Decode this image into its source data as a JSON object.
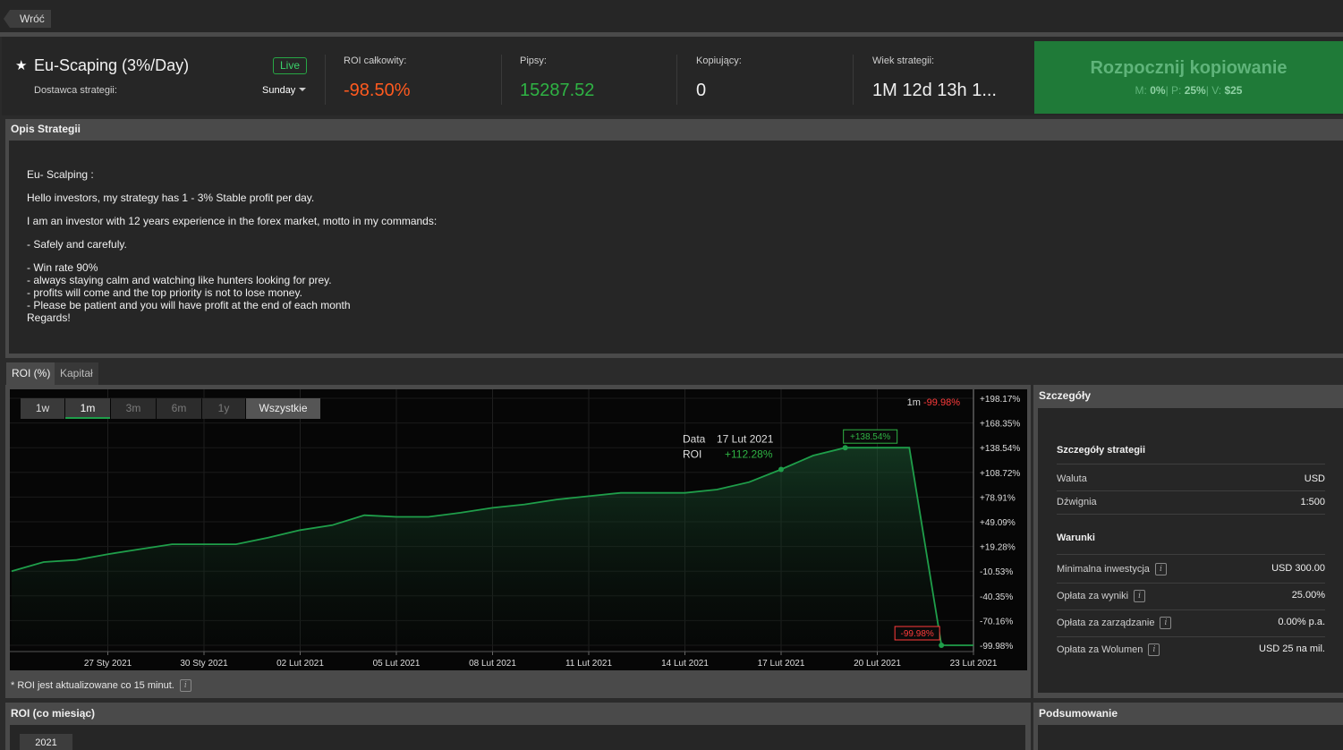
{
  "nav": {
    "back_label": "Wróć"
  },
  "header": {
    "title": "Eu-Scaping (3%/Day)",
    "status_badge": "Live",
    "provider_label": "Dostawca strategii:",
    "provider_name": "Sunday",
    "stats": [
      {
        "label": "ROI całkowity:",
        "value": "-98.50%",
        "color": "#ff5a1f"
      },
      {
        "label": "Pipsy:",
        "value": "15287.52",
        "color": "#2fb344"
      },
      {
        "label": "Kopiujący:",
        "value": "0",
        "color": "#f0f0f0"
      },
      {
        "label": "Wiek strategii:",
        "value": "1M 12d 13h 1...",
        "color": "#f0f0f0"
      }
    ],
    "copy_button": {
      "label": "Rozpocznij kopiowanie",
      "m_label": "M:",
      "m_value": "0%",
      "p_label": "P:",
      "p_value": "25%",
      "v_label": "V:",
      "v_value": "$25"
    }
  },
  "description": {
    "heading": "Opis Strategii",
    "paragraphs": [
      [
        "Eu- Scalping :"
      ],
      [
        "Hello investors, my strategy has 1 - 3% Stable profit per day."
      ],
      [
        "I am an investor with 12 years experience in the forex market, motto in my commands:"
      ],
      [
        "- Safely and carefuly."
      ],
      [
        "- Win rate 90%",
        "- always staying calm and watching like hunters looking for prey.",
        "- profits will come and the top priority is not to lose money.",
        "- Please be patient and you will have profit at the end of each month",
        "Regards!"
      ]
    ]
  },
  "chart_tabs": [
    "ROI (%)",
    "Kapitał"
  ],
  "range_buttons": [
    "1w",
    "1m",
    "3m",
    "6m",
    "1y",
    "Wszystkie"
  ],
  "chart_footnote": "* ROI jest aktualizowane co 15 minut.",
  "chart_data": {
    "type": "area",
    "series": [
      {
        "name": "ROI",
        "x": [
          "24 Sty 2021",
          "25 Sty 2021",
          "26 Sty 2021",
          "27 Sty 2021",
          "28 Sty 2021",
          "29 Sty 2021",
          "30 Sty 2021",
          "31 Sty 2021",
          "01 Lut 2021",
          "02 Lut 2021",
          "03 Lut 2021",
          "04 Lut 2021",
          "05 Lut 2021",
          "06 Lut 2021",
          "07 Lut 2021",
          "08 Lut 2021",
          "09 Lut 2021",
          "10 Lut 2021",
          "11 Lut 2021",
          "12 Lut 2021",
          "13 Lut 2021",
          "14 Lut 2021",
          "15 Lut 2021",
          "16 Lut 2021",
          "17 Lut 2021",
          "18 Lut 2021",
          "19 Lut 2021",
          "20 Lut 2021",
          "21 Lut 2021",
          "22 Lut 2021",
          "23 Lut 2021"
        ],
        "values": [
          -10.5,
          0.5,
          3.0,
          10.0,
          16.0,
          22.0,
          22.0,
          22.0,
          30.0,
          39.0,
          45.0,
          57.0,
          55.0,
          55.0,
          60.0,
          66.0,
          70.0,
          76.0,
          80.0,
          84.0,
          84.0,
          84.0,
          88.0,
          97.0,
          112.28,
          129.0,
          138.54,
          138.54,
          138.54,
          -99.98,
          -99.98
        ]
      }
    ],
    "x_ticks": [
      "27 Sty 2021",
      "30 Sty 2021",
      "02 Lut 2021",
      "05 Lut 2021",
      "08 Lut 2021",
      "11 Lut 2021",
      "14 Lut 2021",
      "17 Lut 2021",
      "20 Lut 2021",
      "23 Lut 2021"
    ],
    "y_ticks": [
      "+198.17%",
      "+168.35%",
      "+138.54%",
      "+108.72%",
      "+78.91%",
      "+49.09%",
      "+19.28%",
      "-10.53%",
      "-40.35%",
      "-70.16%",
      "-99.98%"
    ],
    "ylim": [
      -99.98,
      198.17
    ],
    "legend_text": "1m",
    "legend_value": "-99.98%",
    "tooltip": {
      "date_label": "Data",
      "date_value": "17 Lut 2021",
      "roi_label": "ROI",
      "roi_value": "+112.28%"
    },
    "max_label": "+138.54%",
    "min_label": "-99.98%",
    "grid": true,
    "colors": {
      "line": "#1f9e4a",
      "positive": "#2fb344",
      "negative": "#ff3b3b"
    }
  },
  "details": {
    "heading": "Szczegóły",
    "section1_title": "Szczegóły strategii",
    "rows1": [
      {
        "label": "Waluta",
        "value": "USD"
      },
      {
        "label": "Dźwignia",
        "value": "1:500"
      }
    ],
    "section2_title": "Warunki",
    "rows2": [
      {
        "label": "Minimalna inwestycja",
        "value": "USD 300.00"
      },
      {
        "label": "Opłata za wyniki",
        "value": "25.00%"
      },
      {
        "label": "Opłata za zarządzanie",
        "value": "0.00% p.a."
      },
      {
        "label": "Opłata za Wolumen",
        "value": "USD 25 na mil."
      }
    ]
  },
  "monthly": {
    "heading": "ROI (co miesiąc)",
    "year_tab": "2021"
  },
  "summary": {
    "heading": "Podsumowanie"
  }
}
